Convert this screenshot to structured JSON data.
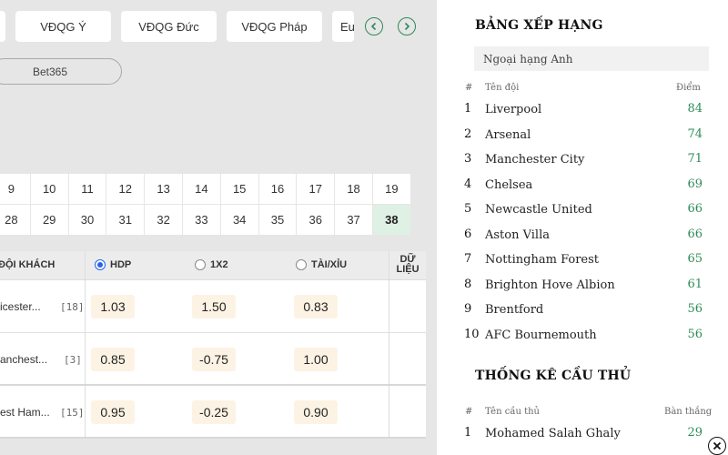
{
  "league_tabs": [
    {
      "label": ""
    },
    {
      "label": "VĐQG Ý"
    },
    {
      "label": "VĐQG Đức"
    },
    {
      "label": "VĐQG Pháp"
    },
    {
      "label": "Eu"
    }
  ],
  "bookmaker": {
    "label": "Bet365"
  },
  "rounds": {
    "row1": [
      "9",
      "10",
      "11",
      "12",
      "13",
      "14",
      "15",
      "16",
      "17",
      "18",
      "19"
    ],
    "row2": [
      "28",
      "29",
      "30",
      "31",
      "32",
      "33",
      "34",
      "35",
      "36",
      "37",
      "38"
    ],
    "active": "38"
  },
  "match_table": {
    "headers": {
      "away": "ĐỘI KHÁCH",
      "hdp": "HDP",
      "onextwo": "1X2",
      "taixiu": "TÀI/XỈU",
      "data": "DỮ LIỆU"
    },
    "selected_option": "HDP",
    "rows": [
      {
        "team": "icester...",
        "rank": "[18]",
        "hdp": "1.03",
        "x12": "1.50",
        "tx": "0.83"
      },
      {
        "team": "anchest...",
        "rank": "[3]",
        "hdp": "0.85",
        "x12": "-0.75",
        "tx": "1.00"
      },
      {
        "team": "est Ham...",
        "rank": "[15]",
        "hdp": "0.95",
        "x12": "-0.25",
        "tx": "0.90"
      }
    ]
  },
  "standings": {
    "title": "BẢNG XẾP HẠNG",
    "league": "Ngoại hạng Anh",
    "col_idx": "#",
    "col_team": "Tên đội",
    "col_points": "Điểm",
    "rows": [
      {
        "idx": "1",
        "team": "Liverpool",
        "points": "84"
      },
      {
        "idx": "2",
        "team": "Arsenal",
        "points": "74"
      },
      {
        "idx": "3",
        "team": "Manchester City",
        "points": "71"
      },
      {
        "idx": "4",
        "team": "Chelsea",
        "points": "69"
      },
      {
        "idx": "5",
        "team": "Newcastle United",
        "points": "66"
      },
      {
        "idx": "6",
        "team": "Aston Villa",
        "points": "66"
      },
      {
        "idx": "7",
        "team": "Nottingham Forest",
        "points": "65"
      },
      {
        "idx": "8",
        "team": "Brighton Hove Albion",
        "points": "61"
      },
      {
        "idx": "9",
        "team": "Brentford",
        "points": "56"
      },
      {
        "idx": "10",
        "team": "AFC Bournemouth",
        "points": "56"
      }
    ]
  },
  "player_stats": {
    "title": "THỐNG KÊ CẦU THỦ",
    "col_idx": "#",
    "col_player": "Tên cầu thủ",
    "col_goals": "Bàn thắng",
    "rows": [
      {
        "idx": "1",
        "player": "Mohamed Salah Ghaly",
        "goals": "29"
      }
    ]
  },
  "colors": {
    "accent": "#2e8b57",
    "odds_bg": "#fdf3e4",
    "active_round": "#dff0e4",
    "radio": "#2563eb"
  }
}
